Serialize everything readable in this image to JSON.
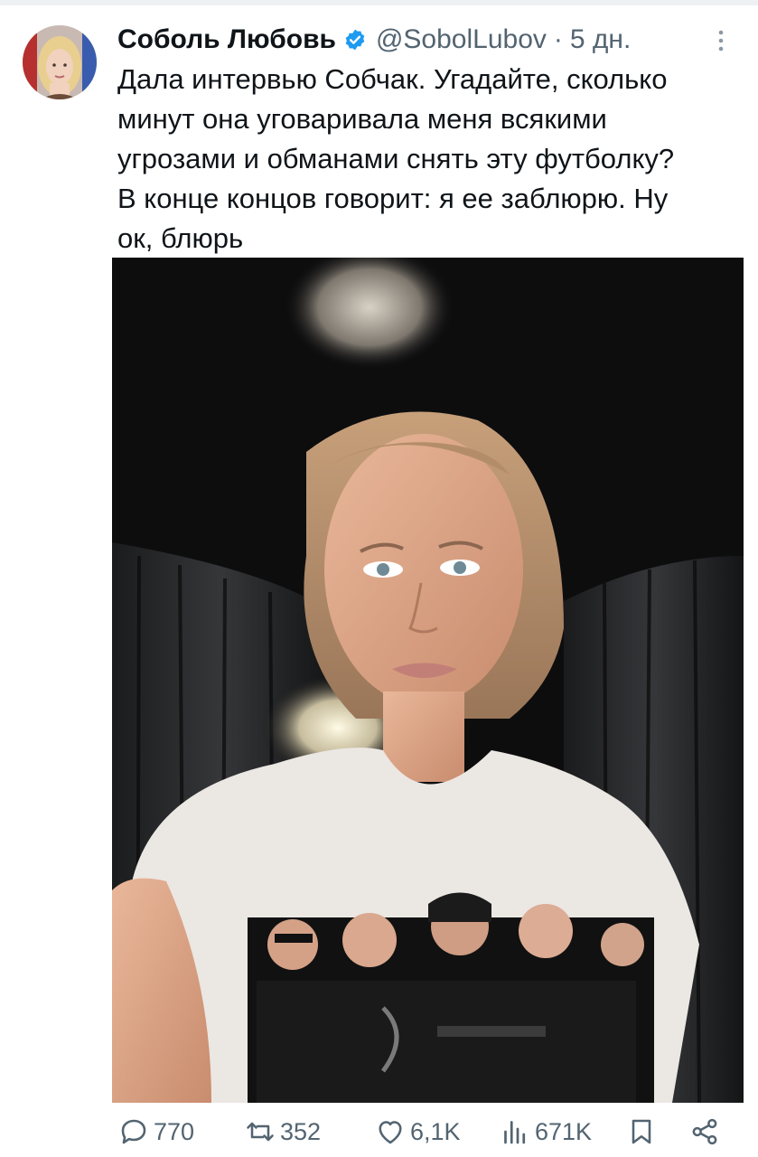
{
  "tweet": {
    "author": {
      "display_name": "Соболь Любовь",
      "handle": "@SobolLubov",
      "separator": "·",
      "time": "5 дн.",
      "verified": true
    },
    "text": "Дала интервью Собчак. Угадайте, сколько\nминут она уговаривала меня всякими\nугрозами и обманами снять эту футболку?\nВ конце концов говорит: я ее заблюрю. Ну\nок, блюрь",
    "media": {
      "icon": "photo"
    },
    "actions": {
      "reply": {
        "icon": "reply-icon",
        "count": "770"
      },
      "retweet": {
        "icon": "retweet-icon",
        "count": "352"
      },
      "like": {
        "icon": "like-icon",
        "count": "6,1K"
      },
      "views": {
        "icon": "views-icon",
        "count": "671K"
      },
      "bookmark": {
        "icon": "bookmark-icon"
      },
      "share": {
        "icon": "share-icon"
      }
    }
  },
  "colors": {
    "text": "#0f1419",
    "secondary": "#536471",
    "verified": "#1d9bf0",
    "divider": "#eef1f4"
  }
}
